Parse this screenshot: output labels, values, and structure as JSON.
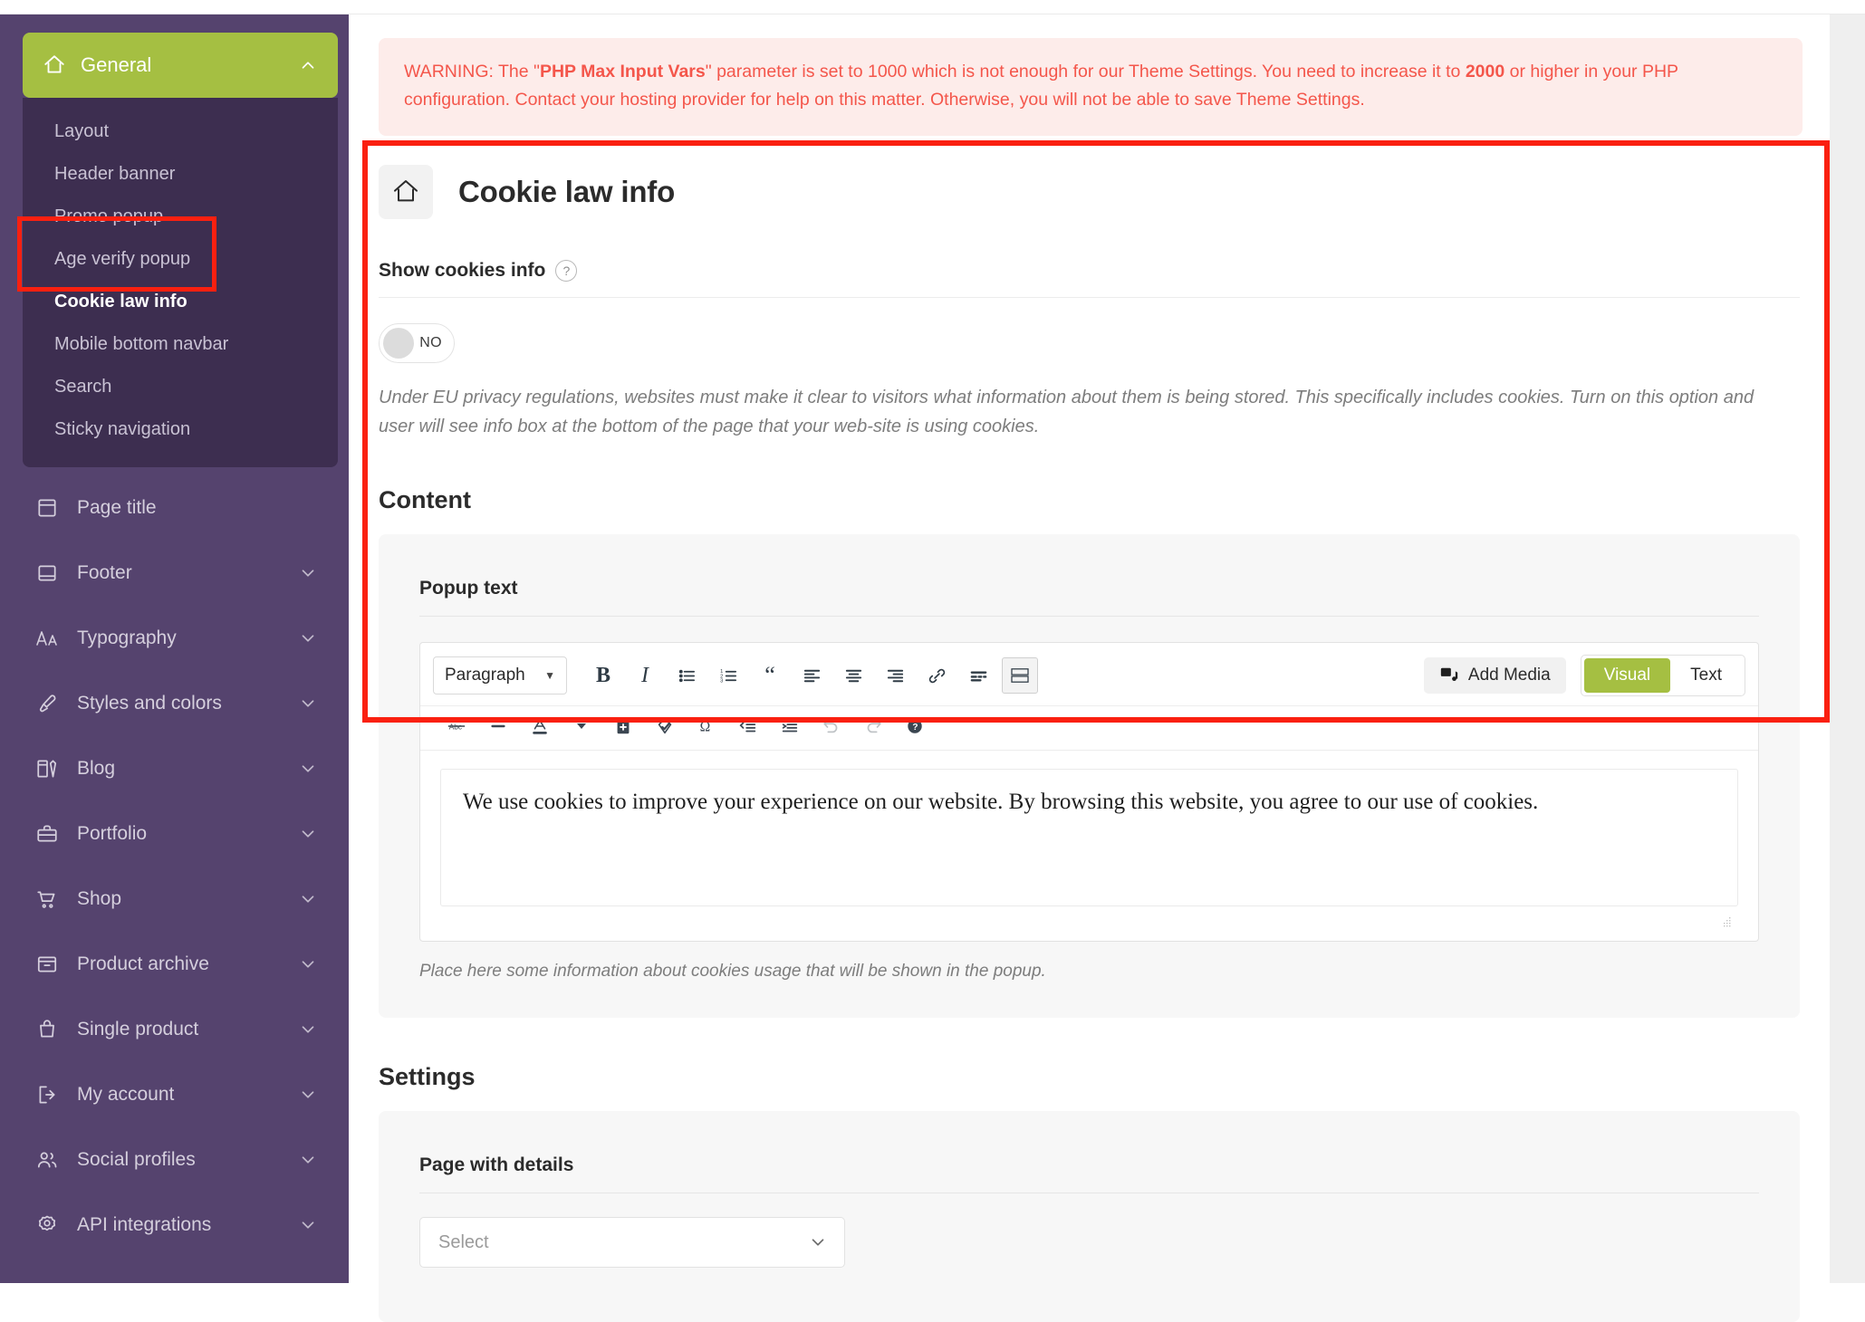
{
  "sidebar": {
    "group": {
      "label": "General",
      "icon": "home-icon",
      "chevron": "chevron-up-icon",
      "submenu": [
        {
          "label": "Layout",
          "active": false
        },
        {
          "label": "Header banner",
          "active": false
        },
        {
          "label": "Promo popup",
          "active": false
        },
        {
          "label": "Age verify popup",
          "active": false
        },
        {
          "label": "Cookie law info",
          "active": true
        },
        {
          "label": "Mobile bottom navbar",
          "active": false
        },
        {
          "label": "Search",
          "active": false
        },
        {
          "label": "Sticky navigation",
          "active": false
        }
      ]
    },
    "items": [
      {
        "label": "Page title",
        "icon": "page-title-icon",
        "chevron": false
      },
      {
        "label": "Footer",
        "icon": "footer-icon",
        "chevron": true
      },
      {
        "label": "Typography",
        "icon": "typography-icon",
        "chevron": true
      },
      {
        "label": "Styles and colors",
        "icon": "brush-icon",
        "chevron": true
      },
      {
        "label": "Blog",
        "icon": "blog-icon",
        "chevron": true
      },
      {
        "label": "Portfolio",
        "icon": "portfolio-icon",
        "chevron": true
      },
      {
        "label": "Shop",
        "icon": "cart-icon",
        "chevron": true
      },
      {
        "label": "Product archive",
        "icon": "archive-icon",
        "chevron": true
      },
      {
        "label": "Single product",
        "icon": "bag-icon",
        "chevron": true
      },
      {
        "label": "My account",
        "icon": "login-icon",
        "chevron": true
      },
      {
        "label": "Social profiles",
        "icon": "users-icon",
        "chevron": true
      },
      {
        "label": "API integrations",
        "icon": "gear-icon",
        "chevron": true
      }
    ]
  },
  "warning": {
    "part1": "WARNING: The \"",
    "bold1": "PHP Max Input Vars",
    "part2": "\" parameter is set to 1000 which is not enough for our Theme Settings. You need to increase it to ",
    "bold2": "2000",
    "part3": " or higher in your PHP configuration. Contact your hosting provider for help on this matter. Otherwise, you will not be able to save Theme Settings."
  },
  "page": {
    "icon": "home-icon",
    "title": "Cookie law info"
  },
  "show_cookies": {
    "label": "Show cookies info",
    "help": "?",
    "toggle_value": "NO",
    "toggle_state": "off",
    "description": "Under EU privacy regulations, websites must make it clear to visitors what information about them is being stored. This specifically includes cookies. Turn on this option and user will see info box at the bottom of the page that your web-site is using cookies."
  },
  "content": {
    "heading": "Content",
    "field_label": "Popup text",
    "editor": {
      "format_select": "Paragraph",
      "toolbar_row1": [
        "bold-icon",
        "italic-icon",
        "bulleted-list-icon",
        "numbered-list-icon",
        "blockquote-icon",
        "align-left-icon",
        "align-center-icon",
        "align-right-icon",
        "link-icon",
        "read-more-icon",
        "toolbar-toggle-icon"
      ],
      "toolbar_row2": [
        "strikethrough-icon",
        "horizontal-rule-icon",
        "text-color-icon",
        "color-caret-icon",
        "paste-as-text-icon",
        "clear-formatting-icon",
        "special-character-icon",
        "outdent-icon",
        "indent-icon",
        "undo-icon",
        "redo-icon",
        "keyboard-help-icon"
      ],
      "add_media_label": "Add Media",
      "add_media_icon": "media-icon",
      "tab_visual": "Visual",
      "tab_text": "Text",
      "active_tab": "Visual",
      "body_text": "We use cookies to improve your experience on our website. By browsing this website, you agree to our use of cookies.",
      "resize_handle": "resize-grip-icon"
    },
    "hint": "Place here some information about cookies usage that will be shown in the popup."
  },
  "settings": {
    "heading": "Settings",
    "field_label": "Page with details",
    "select_placeholder": "Select",
    "select_chevron": "chevron-down-icon"
  },
  "colors": {
    "accent_green": "#a5bf42",
    "sidebar_purple": "#55436e",
    "submenu_purple": "#3d2e50",
    "warning_text": "#f4564b",
    "warning_bg": "#fdecea",
    "highlight_red": "#fa2010"
  }
}
